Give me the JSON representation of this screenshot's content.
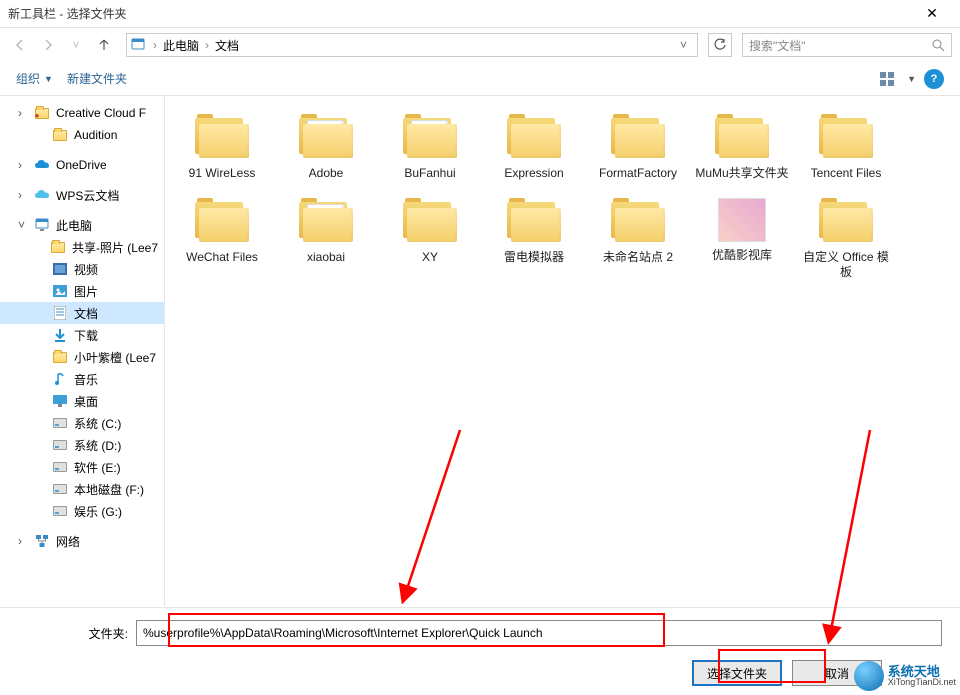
{
  "window": {
    "title": "新工具栏 - 选择文件夹"
  },
  "breadcrumb": {
    "root": "此电脑",
    "current": "文档"
  },
  "search": {
    "placeholder": "搜索\"文档\""
  },
  "toolbar": {
    "organize": "组织",
    "newfolder": "新建文件夹"
  },
  "sidebar": {
    "items": [
      {
        "label": "Creative Cloud F",
        "icon": "cc",
        "lvl": 1
      },
      {
        "label": "Audition",
        "icon": "folder",
        "lvl": 2
      },
      {
        "label": "",
        "icon": "spacer",
        "lvl": 1
      },
      {
        "label": "OneDrive",
        "icon": "onedrive",
        "lvl": 1
      },
      {
        "label": "",
        "icon": "spacer",
        "lvl": 1
      },
      {
        "label": "WPS云文档",
        "icon": "wps",
        "lvl": 1
      },
      {
        "label": "",
        "icon": "spacer",
        "lvl": 1
      },
      {
        "label": "此电脑",
        "icon": "pc",
        "lvl": 1,
        "exp": true
      },
      {
        "label": "共享-照片 (Lee7",
        "icon": "folder-y",
        "lvl": 2
      },
      {
        "label": "视频",
        "icon": "video",
        "lvl": 2
      },
      {
        "label": "图片",
        "icon": "pics",
        "lvl": 2
      },
      {
        "label": "文档",
        "icon": "docs",
        "lvl": 2,
        "sel": true
      },
      {
        "label": "下载",
        "icon": "dl",
        "lvl": 2
      },
      {
        "label": "小叶紫檀 (Lee7",
        "icon": "folder-y",
        "lvl": 2
      },
      {
        "label": "音乐",
        "icon": "music",
        "lvl": 2
      },
      {
        "label": "桌面",
        "icon": "desk",
        "lvl": 2
      },
      {
        "label": "系统 (C:)",
        "icon": "drive",
        "lvl": 2
      },
      {
        "label": "系统 (D:)",
        "icon": "drive",
        "lvl": 2
      },
      {
        "label": "软件 (E:)",
        "icon": "drive",
        "lvl": 2
      },
      {
        "label": "本地磁盘 (F:)",
        "icon": "drive",
        "lvl": 2
      },
      {
        "label": "娱乐 (G:)",
        "icon": "drive",
        "lvl": 2
      },
      {
        "label": "",
        "icon": "spacer",
        "lvl": 1
      },
      {
        "label": "网络",
        "icon": "net",
        "lvl": 1
      }
    ]
  },
  "files": [
    {
      "name": "91 WireLess",
      "type": "folder"
    },
    {
      "name": "Adobe",
      "type": "folder-docs"
    },
    {
      "name": "BuFanhui",
      "type": "folder-docs"
    },
    {
      "name": "Expression",
      "type": "folder"
    },
    {
      "name": "FormatFactory",
      "type": "folder"
    },
    {
      "name": "MuMu共享文件夹",
      "type": "folder"
    },
    {
      "name": "Tencent Files",
      "type": "folder"
    },
    {
      "name": "WeChat Files",
      "type": "folder"
    },
    {
      "name": "xiaobai",
      "type": "folder-docs"
    },
    {
      "name": "XY",
      "type": "folder"
    },
    {
      "name": "雷电模拟器",
      "type": "folder"
    },
    {
      "name": "未命名站点 2",
      "type": "folder"
    },
    {
      "name": "优酷影视库",
      "type": "thumb"
    },
    {
      "name": "自定义 Office 模板",
      "type": "folder"
    }
  ],
  "footer": {
    "label": "文件夹:",
    "path": "%userprofile%\\AppData\\Roaming\\Microsoft\\Internet Explorer\\Quick Launch",
    "select": "选择文件夹",
    "cancel": "取消"
  },
  "watermark": {
    "brand": "系统天地",
    "url": "XiTongTianDi.net"
  }
}
